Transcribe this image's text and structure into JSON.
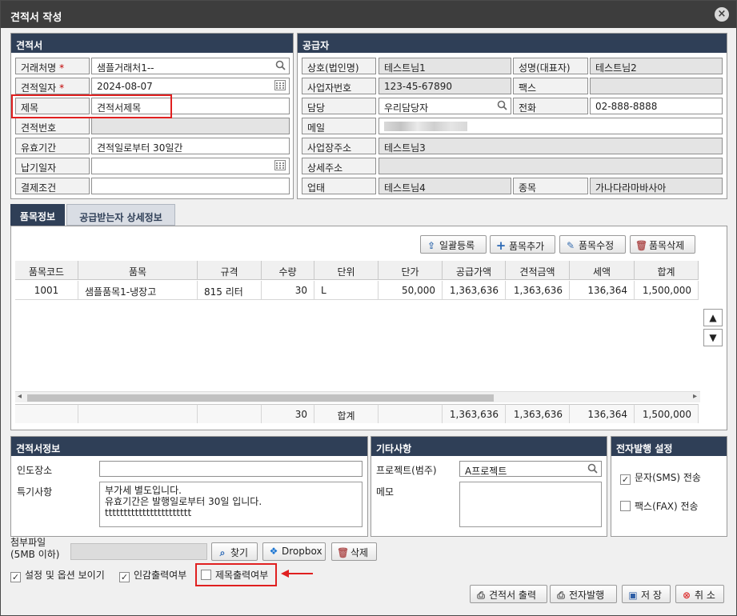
{
  "window": {
    "title": "견적서 작성",
    "close_icon": "×"
  },
  "estimate": {
    "header": "견적서",
    "fields": [
      {
        "label": "거래처명",
        "required": true,
        "value": "샘플거래처1--",
        "icon": "search-icon"
      },
      {
        "label": "견적일자",
        "required": true,
        "value": "2024-08-07",
        "icon": "calendar-icon"
      },
      {
        "label": "제목",
        "required": false,
        "value": "견적서제목"
      },
      {
        "label": "견적번호",
        "required": false,
        "value": ""
      },
      {
        "label": "유효기간",
        "required": false,
        "value": "견적일로부터 30일간"
      },
      {
        "label": "납기일자",
        "required": false,
        "value": "",
        "icon": "calendar-icon"
      },
      {
        "label": "결제조건",
        "required": false,
        "value": ""
      }
    ],
    "required_mark": "*"
  },
  "supplier": {
    "header": "공급자",
    "company_label": "상호(법인명)",
    "company_value": "테스트님1",
    "ceo_label": "성명(대표자)",
    "ceo_value": "테스트님2",
    "bizno_label": "사업자번호",
    "bizno_value": "123-45-67890",
    "fax_label": "팩스",
    "fax_value": "",
    "manager_label": "담당",
    "manager_value": "우리담당자",
    "phone_label": "전화",
    "phone_value": "02-888-8888",
    "email_label": "메일",
    "address_label": "사업장주소",
    "address_value": "테스트님3",
    "address2_label": "상세주소",
    "address2_value": "",
    "biztype_label": "업태",
    "biztype_value": "테스트님4",
    "item_label": "종목",
    "item_value": "가나다라마바사아"
  },
  "tabs": [
    {
      "label": "품목정보",
      "active": true
    },
    {
      "label": "공급받는자 상세정보",
      "active": false
    }
  ],
  "toolbar": {
    "bulk_label": "일괄등록",
    "add_label": "품목추가",
    "edit_label": "품목수정",
    "delete_label": "품목삭제"
  },
  "grid": {
    "columns": [
      "품목코드",
      "품목",
      "규격",
      "수량",
      "단위",
      "단가",
      "공급가액",
      "견적금액",
      "세액",
      "합계"
    ],
    "rows": [
      [
        "1001",
        "샘플품목1-냉장고",
        "815 리터",
        "30",
        "L",
        "50,000",
        "1,363,636",
        "1,363,636",
        "136,364",
        "1,500,000"
      ]
    ],
    "footer": {
      "qty": "30",
      "label": "합계",
      "supply": "1,363,636",
      "estimate": "1,363,636",
      "tax": "136,364",
      "total": "1,500,000"
    },
    "scroll_left": "◂",
    "scroll_right": "▸",
    "up_label": "▲",
    "down_label": "▼"
  },
  "estimate_info": {
    "header": "견적서정보",
    "delivery_label": "인도장소",
    "delivery_value": "",
    "notes_label": "특기사항",
    "notes_value": "부가세 별도입니다.\n유효기간은 발행일로부터 30일 입니다.\nttttttttttttttttttttttt"
  },
  "etc": {
    "header": "기타사항",
    "project_label": "프로젝트(범주)",
    "project_value": "A프로젝트",
    "memo_label": "메모",
    "memo_value": ""
  },
  "e_issue": {
    "header": "전자발행 설정",
    "sms_label": "문자(SMS) 전송",
    "sms_checked": true,
    "fax_label": "팩스(FAX) 전송",
    "fax_checked": false
  },
  "attach": {
    "label_line1": "첨부파일",
    "label_line2": "(5MB 이하)",
    "find_label": "찾기",
    "dropbox_label": "Dropbox",
    "delete_label": "삭제"
  },
  "options": {
    "show_settings_label": "설정 및 옵션 보이기",
    "show_settings_checked": true,
    "seal_label": "인감출력여부",
    "seal_checked": true,
    "title_print_label": "제목출력여부",
    "title_print_checked": false
  },
  "actions": {
    "print_label": "견적서 출력",
    "issue_label": "전자발행",
    "save_label": "저 장",
    "cancel_label": "취 소"
  },
  "colors": {
    "header_bg": "#2f3f57",
    "title_bg": "#3d3d3d",
    "required": "#c00000",
    "highlight": "#e02020"
  }
}
